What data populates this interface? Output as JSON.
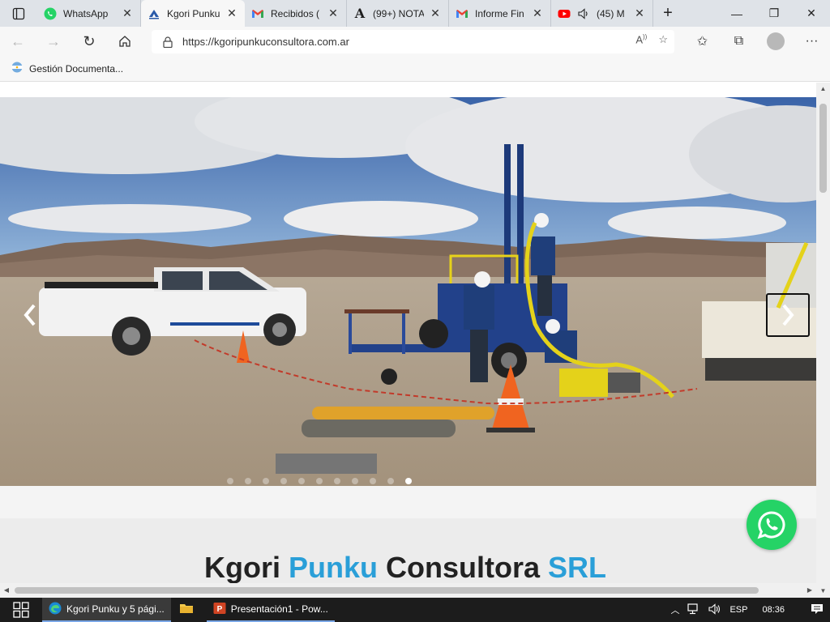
{
  "browser": {
    "tabs": [
      {
        "title": "WhatsApp",
        "icon": "whatsapp-icon",
        "active": false
      },
      {
        "title": "Kgori Punku",
        "icon": "kgori-logo-icon",
        "active": true
      },
      {
        "title": "Recibidos (",
        "icon": "gmail-icon",
        "active": false
      },
      {
        "title": "(99+) NOTA",
        "icon": "font-a-icon",
        "active": false
      },
      {
        "title": "Informe Fin",
        "icon": "gmail-icon",
        "active": false
      },
      {
        "title": "(45) M",
        "icon": "youtube-icon",
        "active": false
      }
    ],
    "url": "https://kgoripunkuconsultora.com.ar",
    "favorites": [
      {
        "label": "Gestión Documenta...",
        "icon": "argentina-flag-icon"
      }
    ]
  },
  "page": {
    "headline": {
      "part1": "Kgori ",
      "part2": "Punku",
      "part3": " Consultora ",
      "part4": "SRL"
    },
    "colors": {
      "accent": "#2a9fd8",
      "whatsapp": "#25d366"
    }
  },
  "taskbar": {
    "items": [
      {
        "label": "Kgori Punku y 5 pági...",
        "icon": "edge-icon",
        "active": true
      },
      {
        "label": "",
        "icon": "folder-icon",
        "active": false
      },
      {
        "label": "Presentación1 - Pow...",
        "icon": "powerpoint-icon",
        "active": false
      }
    ],
    "language": "ESP",
    "time": "08:36"
  }
}
